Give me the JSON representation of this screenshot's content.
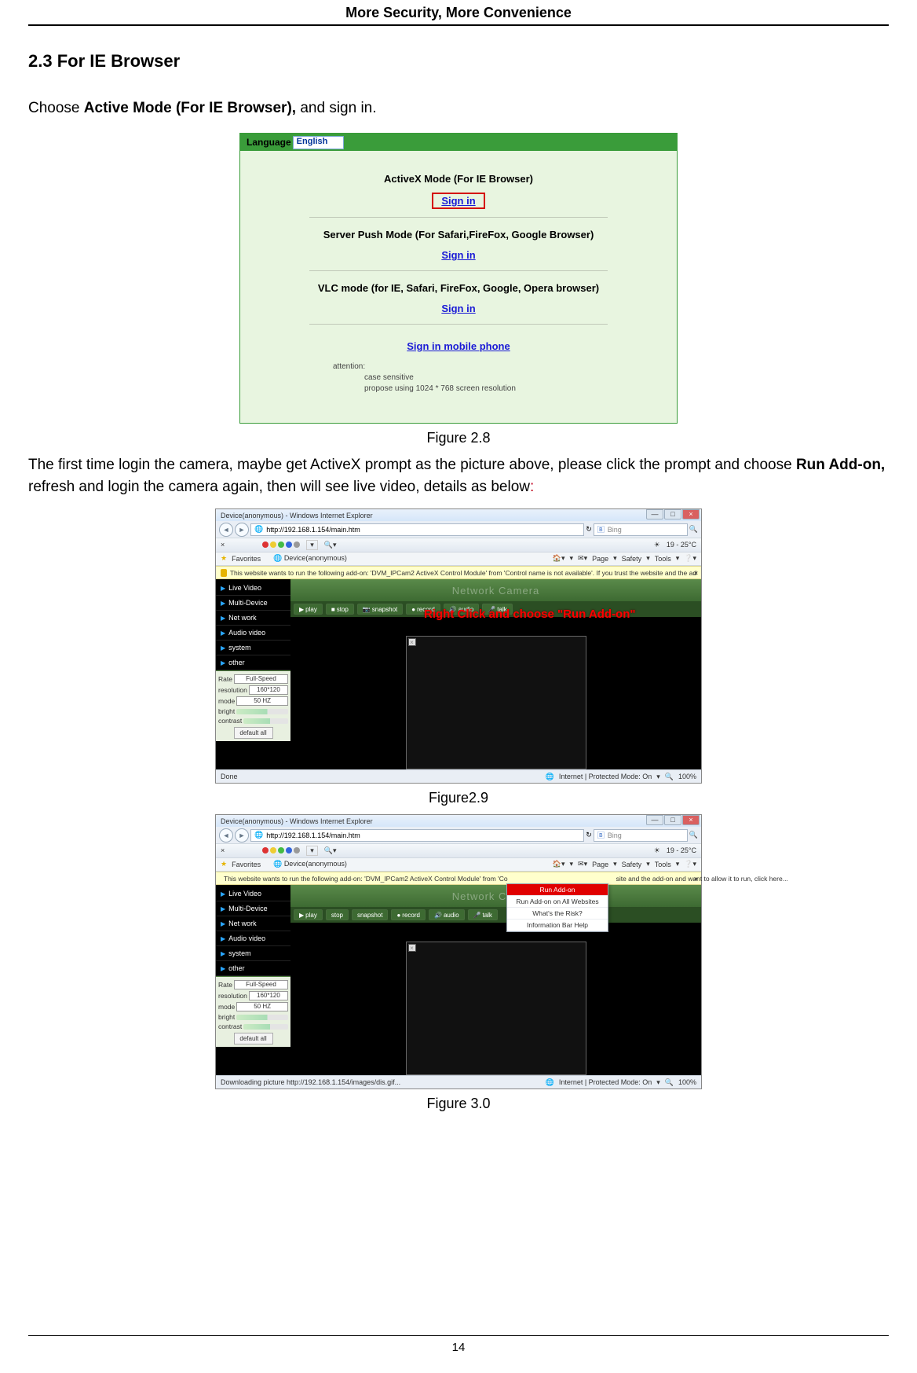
{
  "header": "More Security, More Convenience",
  "section_heading": "2.3 For IE Browser",
  "intro": {
    "pre": "Choose ",
    "bold": "Active Mode (For IE Browser),",
    "post": " and sign in."
  },
  "fig28": {
    "caption": "Figure 2.8",
    "language_label": "Language",
    "language_value": "English",
    "mode1_title": "ActiveX Mode (For IE Browser)",
    "mode1_sign": "Sign in",
    "mode2_title": "Server Push Mode (For Safari,FireFox, Google Browser)",
    "mode2_sign": "Sign in",
    "mode3_title": "VLC mode (for IE, Safari, FireFox, Google, Opera browser)",
    "mode3_sign": "Sign in",
    "mobile_sign": "Sign in mobile phone",
    "attention": "attention:",
    "att1": "case sensitive",
    "att2": "propose using 1024 * 768 screen resolution"
  },
  "para2": {
    "t1": "The first time login the camera, maybe get ActiveX prompt as the picture above, please click the prompt and choose ",
    "bold": "Run Add-on,",
    "t2": " refresh and login the camera again, then will see live video, details as below",
    "colon": ":"
  },
  "fig29": {
    "caption": "Figure2.9",
    "title": "Device(anonymous) - Windows Internet Explorer",
    "url": "http://192.168.1.154/main.htm",
    "search_placeholder": "Bing",
    "fav_label": "Favorites",
    "tab_label": "Device(anonymous)",
    "temp": "19 - 25°C",
    "tools": [
      "Page",
      "Safety",
      "Tools"
    ],
    "infobar": "This website wants to run the following add-on: 'DVM_IPCam2 ActiveX Control Module' from 'Control name is not available'. If you trust the website and the add-on and want to allow it to run, click here...",
    "annotation": "Right Click and choose \"Run Add-on\"",
    "header_title": "Network Camera",
    "side_items": [
      "Live Video",
      "Multi-Device",
      "Net work",
      "Audio video",
      "system",
      "other"
    ],
    "btns": [
      "play",
      "stop",
      "snapshot",
      "record",
      "audio",
      "talk"
    ],
    "ctrl": {
      "rate_label": "Rate",
      "rate_val": "Full-Speed",
      "res_label": "resolution",
      "res_val": "160*120",
      "mode_label": "mode",
      "mode_val": "50 HZ",
      "bright_label": "bright",
      "contrast_label": "contrast",
      "default": "default all"
    },
    "status_left": "Done",
    "status_mid": "Internet | Protected Mode: On",
    "status_zoom": "100%"
  },
  "fig30": {
    "caption": "Figure 3.0",
    "title": "Device(anonymous) - Windows Internet Explorer",
    "url": "http://192.168.1.154/main.htm",
    "search_placeholder": "Bing",
    "fav_label": "Favorites",
    "tab_label": "Device(anonymous)",
    "temp": "19 - 25°C",
    "tools": [
      "Page",
      "Safety",
      "Tools"
    ],
    "infobar": "This website wants to run the following add-on: 'DVM_IPCam2 ActiveX Control Module' from 'Co",
    "infobar_tail": "site and the add-on and want to allow it to run, click here...",
    "menu": [
      "Run Add-on",
      "Run Add-on on All Websites",
      "What's the Risk?",
      "Information Bar Help"
    ],
    "header_title": "Network Camera",
    "side_items": [
      "Live Video",
      "Multi-Device",
      "Net work",
      "Audio video",
      "system",
      "other"
    ],
    "btns": [
      "play",
      "stop",
      "snapshot",
      "record",
      "audio",
      "talk"
    ],
    "ctrl": {
      "rate_label": "Rate",
      "rate_val": "Full-Speed",
      "res_label": "resolution",
      "res_val": "160*120",
      "mode_label": "mode",
      "mode_val": "50 HZ",
      "bright_label": "bright",
      "contrast_label": "contrast",
      "default": "default all"
    },
    "status_left": "Downloading picture http://192.168.1.154/images/dis.gif...",
    "status_mid": "Internet | Protected Mode: On",
    "status_zoom": "100%"
  },
  "page_number": "14"
}
